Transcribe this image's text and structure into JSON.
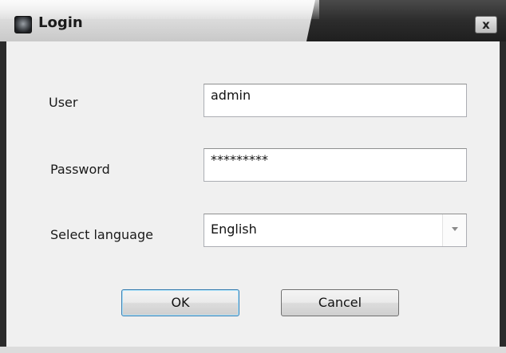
{
  "window": {
    "title": "Login",
    "close_label": "x"
  },
  "form": {
    "user_label": "User",
    "user_value": "admin",
    "password_label": "Password",
    "password_value": "*********",
    "language_label": "Select language",
    "language_value": "English"
  },
  "buttons": {
    "ok_label": "OK",
    "cancel_label": "Cancel"
  }
}
